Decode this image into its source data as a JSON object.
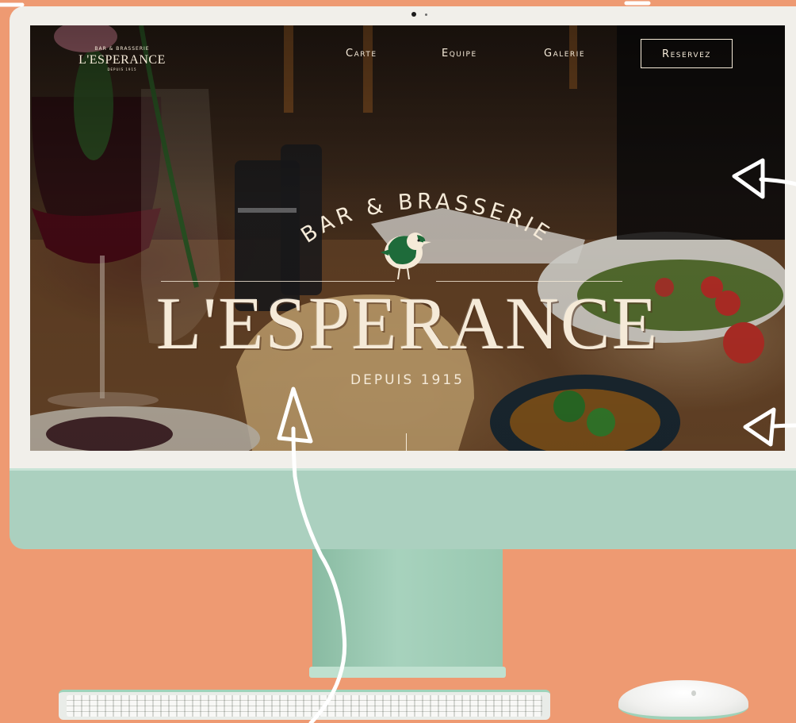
{
  "site": {
    "logo": {
      "arc_text": "BAR & BRASSERIE",
      "name": "L'ESPERANCE",
      "since": "DEPUIS 1915"
    },
    "nav": {
      "items": [
        {
          "label": "Carte"
        },
        {
          "label": "Equipe"
        },
        {
          "label": "Galerie"
        }
      ],
      "cta_label": "Reservez"
    },
    "hero": {
      "arc_text": "BAR & BRASSERIE",
      "title": "L'ESPERANCE",
      "subtitle": "DEPUIS 1915"
    }
  },
  "colors": {
    "background": "#ee9a72",
    "monitor_chin": "#abd0bf",
    "cream_text": "#f5ead8",
    "bird_green": "#1e6b3a"
  },
  "icons": {
    "bird": "robin-bird-icon",
    "doodle_arrows": "hand-drawn-arrow-icon"
  }
}
